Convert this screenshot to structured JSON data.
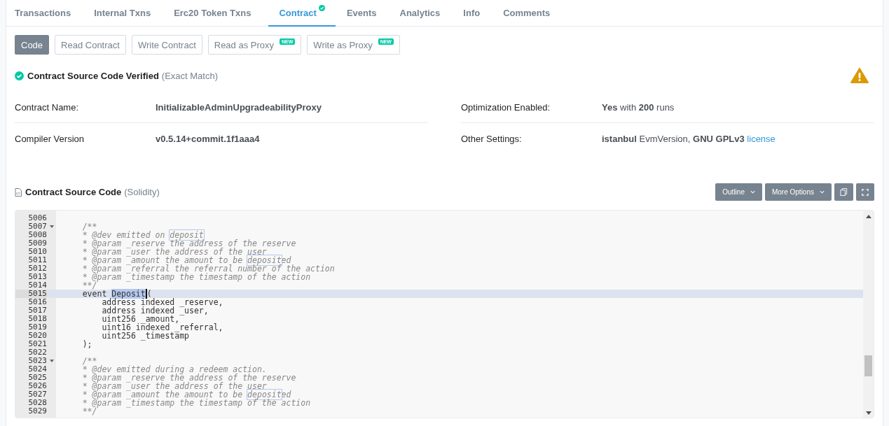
{
  "tabs": [
    {
      "label": "Transactions",
      "selected": false,
      "verified": false
    },
    {
      "label": "Internal Txns",
      "selected": false,
      "verified": false
    },
    {
      "label": "Erc20 Token Txns",
      "selected": false,
      "verified": false
    },
    {
      "label": "Contract",
      "selected": true,
      "verified": true
    },
    {
      "label": "Events",
      "selected": false,
      "verified": false
    },
    {
      "label": "Analytics",
      "selected": false,
      "verified": false
    },
    {
      "label": "Info",
      "selected": false,
      "verified": false
    },
    {
      "label": "Comments",
      "selected": false,
      "verified": false
    }
  ],
  "subtabs": [
    {
      "label": "Code",
      "selected": true
    },
    {
      "label": "Read Contract",
      "selected": false
    },
    {
      "label": "Write Contract",
      "selected": false
    },
    {
      "label": "Read as Proxy",
      "selected": false,
      "badge": "NEW"
    },
    {
      "label": "Write as Proxy",
      "selected": false,
      "badge": "NEW"
    }
  ],
  "verified": {
    "title": "Contract Source Code Verified",
    "note": "(Exact Match)"
  },
  "details": [
    [
      {
        "label": "Contract Name:",
        "value": "**InitializableAdminUpgradeabilityProxy**"
      },
      {
        "label": "Compiler Version",
        "value": "**v0.5.14+commit.1f1aaa4**"
      }
    ],
    [
      {
        "label": "Optimization Enabled:",
        "value": "**Yes** with **200** runs"
      },
      {
        "label": "Other Settings:",
        "value": "**istanbul** EvmVersion, **GNU GPLv3**",
        "link": "license"
      }
    ]
  ],
  "source": {
    "title": "Contract Source Code",
    "language": "(Solidity)",
    "buttons": [
      {
        "label": "Outline",
        "kind": "dropdown"
      },
      {
        "label": "More Options",
        "kind": "dropdown"
      },
      {
        "kind": "copy"
      },
      {
        "kind": "fullscreen"
      }
    ]
  },
  "code_lines": [
    {
      "number": "5006",
      "kind": "blank",
      "fold": false,
      "current": false
    },
    {
      "number": "5007",
      "kind": "comment",
      "fold": true,
      "current": false,
      "parts": [
        {
          "text": "    /**",
          "kind": "plain"
        }
      ]
    },
    {
      "number": "5008",
      "kind": "comment",
      "fold": false,
      "current": false,
      "parts": [
        {
          "text": "    * @dev emitted on ",
          "kind": "plain"
        },
        {
          "text": "deposit",
          "kind": "match"
        }
      ]
    },
    {
      "number": "5009",
      "kind": "comment",
      "fold": false,
      "current": false,
      "parts": [
        {
          "text": "    * @param _reserve the address of the reserve",
          "kind": "plain"
        }
      ]
    },
    {
      "number": "5010",
      "kind": "comment",
      "fold": false,
      "current": false,
      "parts": [
        {
          "text": "    * @param _user the address of the user",
          "kind": "plain"
        }
      ]
    },
    {
      "number": "5011",
      "kind": "comment",
      "fold": false,
      "current": false,
      "parts": [
        {
          "text": "    * @param _amount the amount to be ",
          "kind": "plain"
        },
        {
          "text": "deposit",
          "kind": "match"
        },
        {
          "text": "ed",
          "kind": "plain"
        }
      ]
    },
    {
      "number": "5012",
      "kind": "comment",
      "fold": false,
      "current": false,
      "parts": [
        {
          "text": "    * @param _referral the referral number of the action",
          "kind": "plain"
        }
      ]
    },
    {
      "number": "5013",
      "kind": "comment",
      "fold": false,
      "current": false,
      "parts": [
        {
          "text": "    * @param _timestamp the timestamp of the action",
          "kind": "plain"
        }
      ]
    },
    {
      "number": "5014",
      "kind": "comment",
      "fold": false,
      "current": false,
      "parts": [
        {
          "text": "    **/",
          "kind": "plain"
        }
      ]
    },
    {
      "number": "5015",
      "kind": "code",
      "fold": false,
      "current": true,
      "parts": [
        {
          "text": "    event ",
          "kind": "plain"
        },
        {
          "text": "Deposit",
          "kind": "selection"
        },
        {
          "text": "(",
          "kind": "plain"
        }
      ]
    },
    {
      "number": "5016",
      "kind": "code",
      "fold": false,
      "current": false,
      "parts": [
        {
          "text": "        address indexed _reserve,",
          "kind": "plain"
        }
      ]
    },
    {
      "number": "5017",
      "kind": "code",
      "fold": false,
      "current": false,
      "parts": [
        {
          "text": "        address indexed _user,",
          "kind": "plain"
        }
      ]
    },
    {
      "number": "5018",
      "kind": "code",
      "fold": false,
      "current": false,
      "parts": [
        {
          "text": "        uint256 _amount,",
          "kind": "plain"
        }
      ]
    },
    {
      "number": "5019",
      "kind": "code",
      "fold": false,
      "current": false,
      "parts": [
        {
          "text": "        uint16 indexed _referral,",
          "kind": "plain"
        }
      ]
    },
    {
      "number": "5020",
      "kind": "code",
      "fold": false,
      "current": false,
      "parts": [
        {
          "text": "        uint256 _timestamp",
          "kind": "plain"
        }
      ]
    },
    {
      "number": "5021",
      "kind": "code",
      "fold": false,
      "current": false,
      "parts": [
        {
          "text": "    );",
          "kind": "plain"
        }
      ]
    },
    {
      "number": "5022",
      "kind": "blank",
      "fold": false,
      "current": false
    },
    {
      "number": "5023",
      "kind": "comment",
      "fold": true,
      "current": false,
      "parts": [
        {
          "text": "    /**",
          "kind": "plain"
        }
      ]
    },
    {
      "number": "5024",
      "kind": "comment",
      "fold": false,
      "current": false,
      "parts": [
        {
          "text": "    * @dev emitted during a redeem action.",
          "kind": "plain"
        }
      ]
    },
    {
      "number": "5025",
      "kind": "comment",
      "fold": false,
      "current": false,
      "parts": [
        {
          "text": "    * @param _reserve the address of the reserve",
          "kind": "plain"
        }
      ]
    },
    {
      "number": "5026",
      "kind": "comment",
      "fold": false,
      "current": false,
      "parts": [
        {
          "text": "    * @param _user the address of the user",
          "kind": "plain"
        }
      ]
    },
    {
      "number": "5027",
      "kind": "comment",
      "fold": false,
      "current": false,
      "parts": [
        {
          "text": "    * @param _amount the amount to be ",
          "kind": "plain"
        },
        {
          "text": "deposit",
          "kind": "match"
        },
        {
          "text": "ed",
          "kind": "plain"
        }
      ]
    },
    {
      "number": "5028",
      "kind": "comment",
      "fold": false,
      "current": false,
      "parts": [
        {
          "text": "    * @param _timestamp the timestamp of the action",
          "kind": "plain"
        }
      ]
    },
    {
      "number": "5029",
      "kind": "comment",
      "fold": false,
      "current": false,
      "parts": [
        {
          "text": "    **/",
          "kind": "plain"
        }
      ]
    }
  ]
}
